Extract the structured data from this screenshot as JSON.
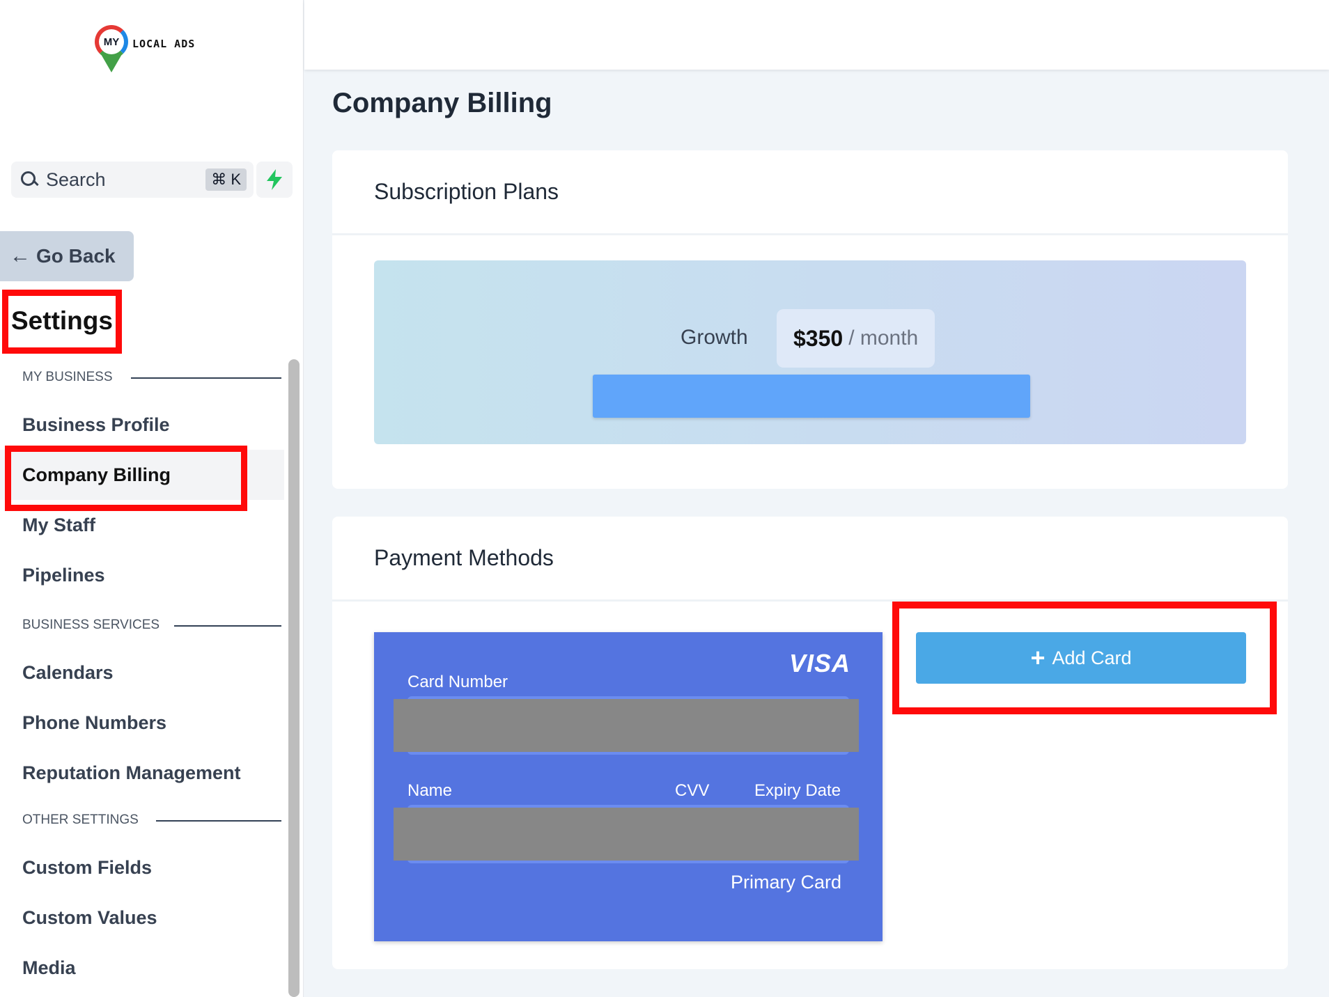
{
  "logo": {
    "badge": "MY",
    "text": "LOCAL ADS"
  },
  "search": {
    "label": "Search",
    "shortcut": "⌘ K"
  },
  "sidebar": {
    "go_back": "Go Back",
    "title": "Settings",
    "sections": [
      {
        "label": "MY BUSINESS",
        "items": [
          "Business Profile",
          "Company Billing",
          "My Staff",
          "Pipelines"
        ]
      },
      {
        "label": "BUSINESS SERVICES",
        "items": [
          "Calendars",
          "Phone Numbers",
          "Reputation Management"
        ]
      },
      {
        "label": "OTHER SETTINGS",
        "items": [
          "Custom Fields",
          "Custom Values",
          "Media"
        ]
      }
    ],
    "active_item": "Company Billing"
  },
  "main": {
    "page_title": "Company Billing",
    "subscription": {
      "header": "Subscription Plans",
      "plan_name": "Growth",
      "price": "$350",
      "period": "/ month"
    },
    "payment": {
      "header": "Payment Methods",
      "card_brand": "VISA",
      "card_number_label": "Card Number",
      "name_label": "Name",
      "cvv_label": "CVV",
      "expiry_label": "Expiry Date",
      "primary_label": "Primary Card",
      "add_card_label": "Add Card"
    }
  },
  "colors": {
    "highlight": "#ff0a0a",
    "card_bg": "#5474e0",
    "add_card_bg": "#4aa8e6",
    "plan_bar": "#60a5fa",
    "bolt": "#22c55e"
  }
}
